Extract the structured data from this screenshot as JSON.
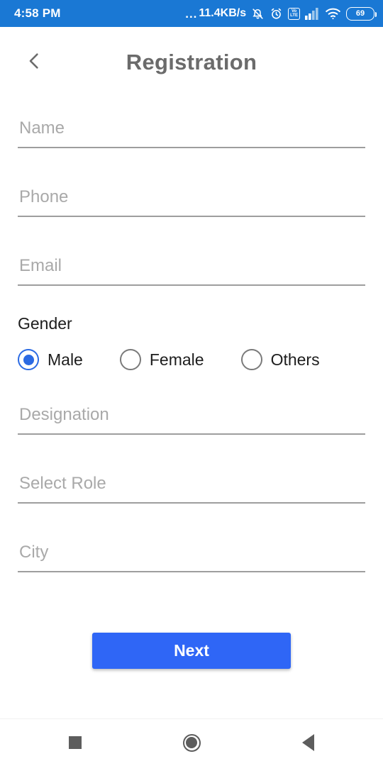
{
  "colors": {
    "statusbar_bg": "#1a78d4",
    "accent_button": "#2f66f6",
    "radio_selected": "#2b6ae3",
    "title_gray": "#6b6b6b",
    "placeholder_gray": "#a9a9a9",
    "underline_gray": "#9e9e9e",
    "nav_icon_gray": "#5d5d5d"
  },
  "statusbar": {
    "time": "4:58 PM",
    "network_speed": "11.4KB/s",
    "speed_prefix": "...",
    "icons": [
      "bell-muted-icon",
      "alarm-clock-icon",
      "volte-icon",
      "signal-bars-icon",
      "wifi-icon",
      "battery-icon"
    ],
    "volte_top": "Vo",
    "volte_bottom": "LTE",
    "battery_level": "69"
  },
  "header": {
    "back_icon": "chevron-left-icon",
    "title": "Registration"
  },
  "form": {
    "fields": [
      {
        "name": "name",
        "placeholder": "Name",
        "value": ""
      },
      {
        "name": "phone",
        "placeholder": "Phone",
        "value": ""
      },
      {
        "name": "email",
        "placeholder": "Email",
        "value": ""
      },
      {
        "name": "designation",
        "placeholder": "Designation",
        "value": ""
      },
      {
        "name": "role",
        "placeholder": "Select Role",
        "value": ""
      },
      {
        "name": "city",
        "placeholder": "City",
        "value": ""
      }
    ],
    "gender": {
      "label": "Gender",
      "selected": "Male",
      "options": [
        "Male",
        "Female",
        "Others"
      ]
    },
    "submit_label": "Next"
  },
  "navbar": {
    "recents_icon": "square-recents-icon",
    "home_icon": "circle-home-icon",
    "back_icon": "triangle-back-icon"
  }
}
